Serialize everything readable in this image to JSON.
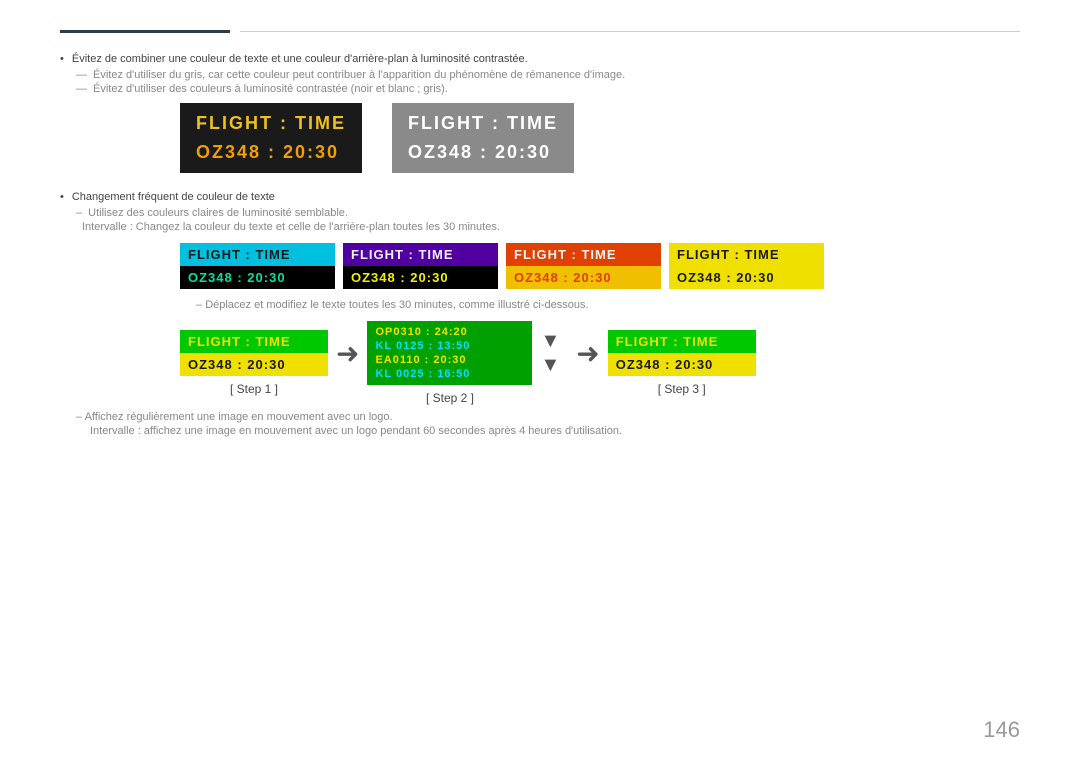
{
  "page": {
    "number": "146"
  },
  "top_lines": {
    "dark_line": true,
    "light_line": true
  },
  "bullets": {
    "item1": "Évitez de combiner une couleur de texte et une couleur d'arrière-plan à luminosité contrastée.",
    "dash1": "Évitez d'utiliser du gris, car cette couleur peut contribuer à l'apparition du phénomène de rémanence d'image.",
    "dash2": "Évitez d'utiliser des couleurs à luminosité contrastée (noir et blanc ; gris)."
  },
  "large_cards": {
    "card1": {
      "row1": "FLIGHT  :  TIME",
      "row2": "OZ348  :  20:30"
    },
    "card2": {
      "row1": "FLIGHT  :  TIME",
      "row2": "OZ348  :  20:30"
    }
  },
  "sub_bullets": {
    "item1": "Changement fréquent de couleur de texte",
    "dash1": "Utilisez des couleurs claires de luminosité semblable.",
    "dash2": "Intervalle : Changez la couleur du texte et celle de l'arrière-plan toutes les 30 minutes."
  },
  "small_cards": {
    "card1": {
      "row1": "FLIGHT  :  TIME",
      "row2": "OZ348  :  20:30"
    },
    "card2": {
      "row1": "FLIGHT  :  TIME",
      "row2": "OZ348  :  20:30"
    },
    "card3": {
      "row1": "FLIGHT  :  TIME",
      "row2": "OZ348  :  20:30"
    },
    "card4": {
      "row1": "FLIGHT  :  TIME",
      "row2": "OZ348  :  20:30"
    }
  },
  "dash_between": "Déplacez et modifiez le texte toutes les 30 minutes, comme illustré ci-dessous.",
  "steps": {
    "step1": {
      "label": "[ Step 1 ]",
      "row1": "FLIGHT  :  TIME",
      "row2": "OZ348  :  20:30"
    },
    "step2": {
      "label": "[ Step 2 ]",
      "rows": [
        "OP0310 :  24:20",
        "KL 0125 :  13:50",
        "EA0110 :  20:30",
        "KL 0025 :  16:50"
      ]
    },
    "step3": {
      "label": "[ Step 3 ]",
      "row1": "FLIGHT  :  TIME",
      "row2": "OZ348  :  20:30"
    }
  },
  "bottom_notes": {
    "dash1": "Affichez régulièrement une image en mouvement avec un logo.",
    "dash2": "Intervalle : affichez une image en mouvement avec un logo pendant 60 secondes après 4 heures d'utilisation."
  }
}
